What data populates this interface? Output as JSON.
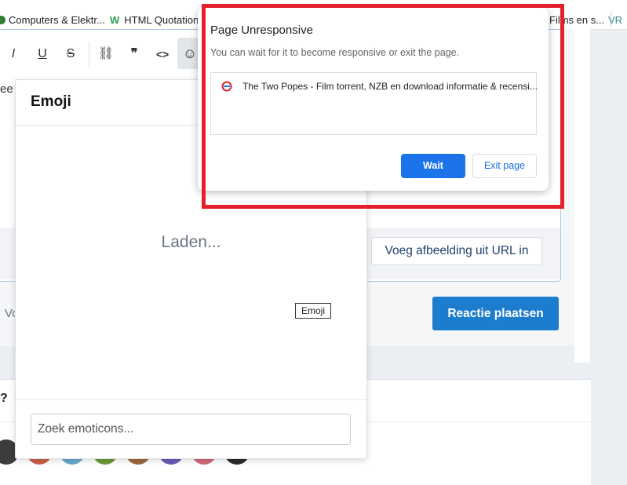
{
  "bookmarks": [
    {
      "label": "Computers & Elektr...",
      "icon": "globe-icon",
      "color": "#2e7d32"
    },
    {
      "label": "HTML Quotation",
      "icon": "w-logo-icon",
      "color": "#2e9e4f"
    },
    {
      "label": "Films en s...",
      "icon": "film-icon",
      "color": "#444444"
    }
  ],
  "editor": {
    "toolbar": [
      {
        "icon": "italic-icon",
        "glyph": "I"
      },
      {
        "icon": "underline-icon",
        "glyph": "U"
      },
      {
        "icon": "strikethrough-icon",
        "glyph": "S"
      },
      {
        "icon": "link-icon",
        "glyph": "⛓"
      },
      {
        "icon": "quote-icon",
        "glyph": "❞"
      },
      {
        "icon": "code-icon",
        "glyph": "<>"
      },
      {
        "icon": "emoji-icon",
        "glyph": "☺"
      }
    ],
    "snippet": "ee",
    "image_url_button": "Voeg afbeelding uit URL in",
    "bottom_left_text": "Vo",
    "post_button": "Reactie plaatsen"
  },
  "lower_section": {
    "question_mark": "?",
    "avatar_colors": [
      "#3c3c3c",
      "#c9604c",
      "#6aa8cf",
      "#6a9a3a",
      "#9b6a3a",
      "#6b5bb8",
      "#d06a7a",
      "#2b2b2b"
    ]
  },
  "emoji_popup": {
    "title": "Emoji",
    "loading": "Laden...",
    "tooltip": "Emoji",
    "search_placeholder": "Zoek emoticons..."
  },
  "dialog": {
    "title": "Page Unresponsive",
    "message": "You can wait for it to become responsive or exit the page.",
    "items": [
      "The Two Popes - Film torrent, NZB en download informatie & recensi..."
    ],
    "wait_button": "Wait",
    "exit_button": "Exit page"
  },
  "colors": {
    "highlight": "#e3202b",
    "primary_button": "#1a73e8",
    "post_button": "#1c7ccd"
  }
}
